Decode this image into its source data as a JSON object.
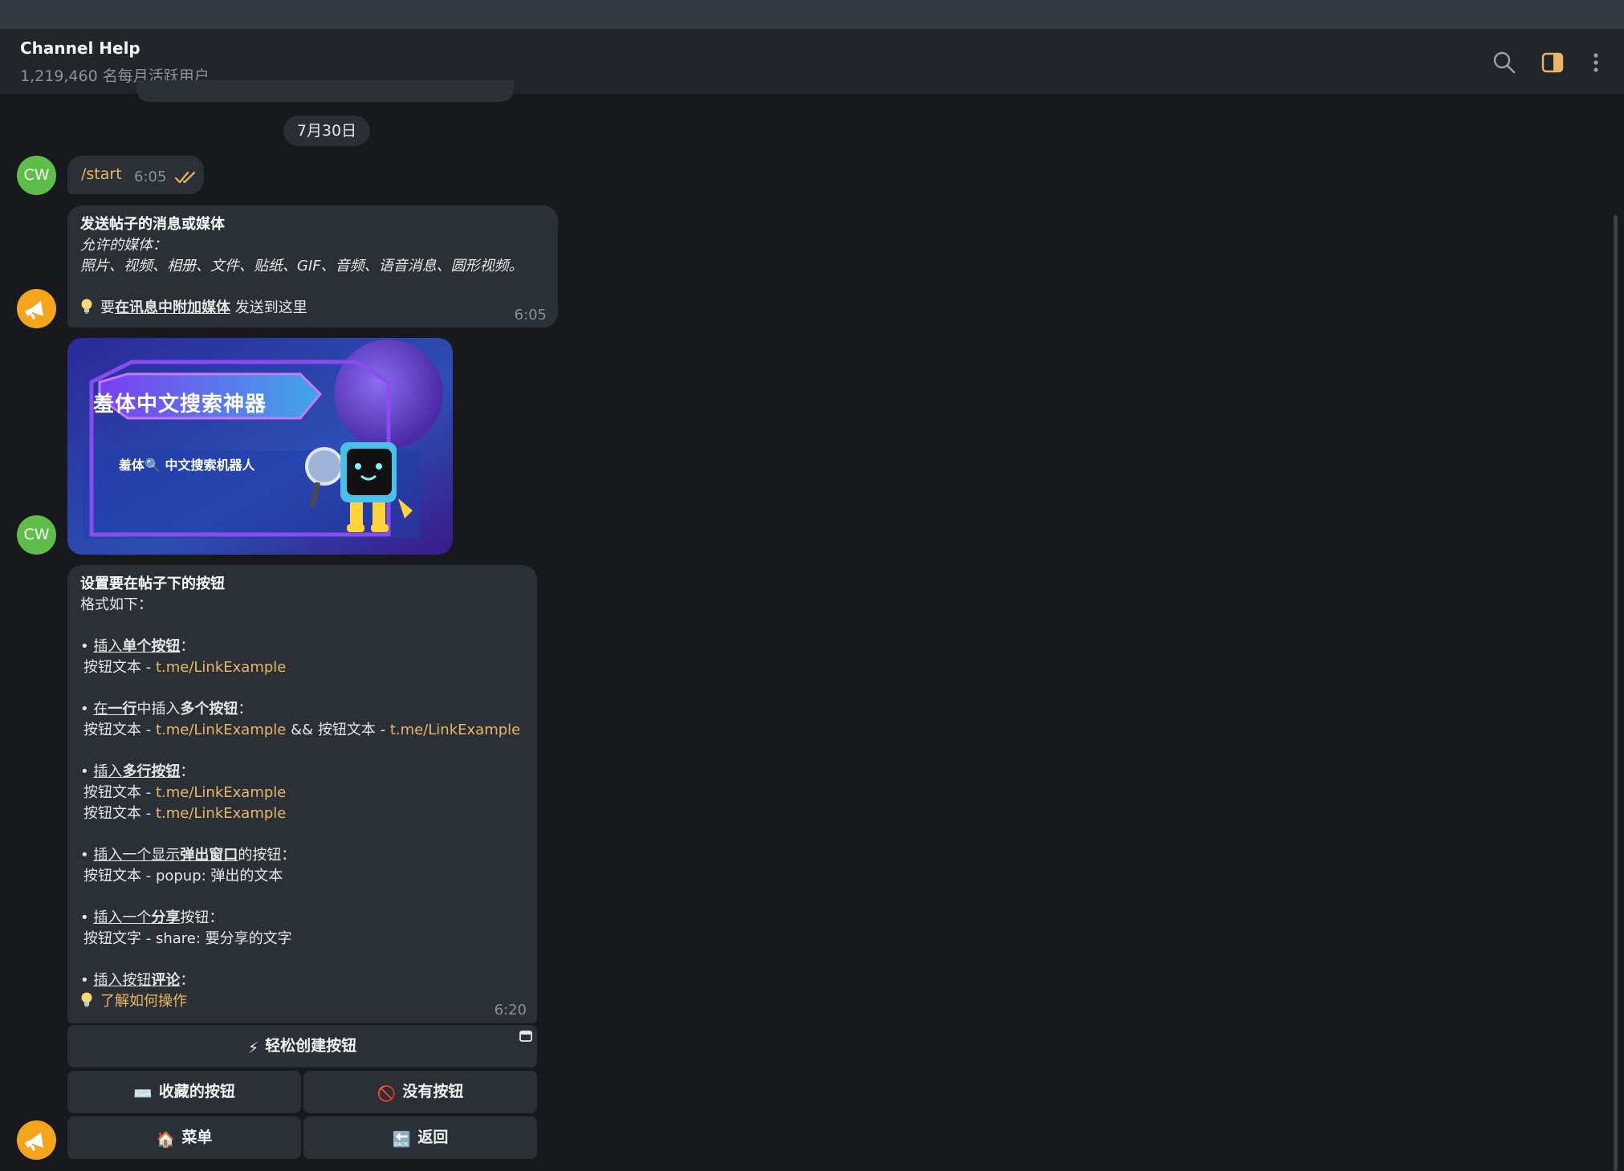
{
  "header": {
    "title": "Channel Help",
    "subtitle": "1,219,460 名每月活跃用户",
    "icons": [
      "search-icon",
      "sidebar-toggle-icon",
      "more-vertical-icon"
    ]
  },
  "chat": {
    "date_separator": "7月30日",
    "messages": [
      {
        "sender": "CW",
        "avatar_color": "#5fbd4a",
        "text": "/start",
        "time": "6:05",
        "status": "read"
      },
      {
        "sender": "bot",
        "avatar_color": "#f4a51c",
        "title": "发送帖子的消息或媒体",
        "allowed_label": "允许的媒体：",
        "allowed_list": "照片、视频、相册、文件、贴纸、GIF、音频、语音消息、圆形视频。",
        "tip_pre": "要",
        "tip_link": "在讯息中附加媒体",
        "tip_post": " 发送到这里",
        "time": "6:05"
      },
      {
        "sender": "CW",
        "image": {
          "title": "羞体中文搜索神器",
          "subtitle": "羞体🔍 中文搜索机器人"
        }
      },
      {
        "sender": "bot",
        "title": "设置要在帖子下的按钮",
        "format_label": "格式如下：",
        "bullet": "• ",
        "colon": "：",
        "sec1": {
          "pre": "插入",
          "bold": "单个按钮"
        },
        "btn_text": "按钮文本 - ",
        "link": "t.me/LinkExample",
        "sec2": {
          "pre": "在",
          "u": "一行",
          "mid": "中插入",
          "bold": "多个按钮"
        },
        "and_text": " && 按钮文本 - ",
        "sec3": {
          "pre": "插入",
          "bold": "多行按钮"
        },
        "sec4": {
          "pre": "插入一个显示",
          "bold": "弹出窗口",
          "post": "的按钮"
        },
        "popup_line": "按钮文本 - popup: 弹出的文本",
        "sec5": {
          "pre": "插入一个",
          "bold": "分享",
          "post": "按钮"
        },
        "share_line": "按钮文字 - share: 要分享的文字",
        "sec6": {
          "pre": "插入按钮",
          "bold": "评论"
        },
        "learn_link": "了解如何操作",
        "time": "6:20"
      }
    ]
  },
  "keyboard": {
    "row1": [
      {
        "emoji": "⚡",
        "label": "轻松创建按钮"
      }
    ],
    "row2": [
      {
        "emoji": "⌨️",
        "label": "收藏的按钮"
      },
      {
        "emoji": "🚫",
        "label": "没有按钮"
      }
    ],
    "row3": [
      {
        "emoji": "🏠",
        "label": "菜单"
      },
      {
        "emoji": "🔙",
        "label": "返回"
      }
    ]
  }
}
